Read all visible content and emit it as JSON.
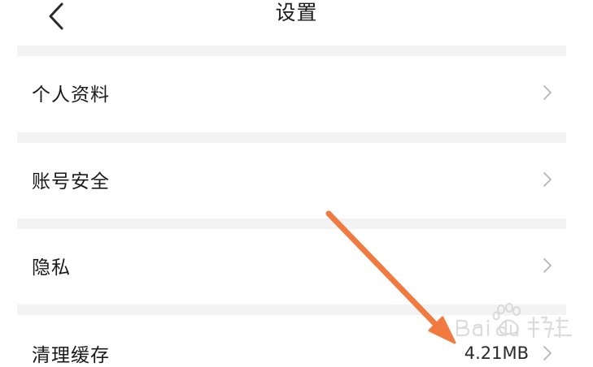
{
  "header": {
    "title": "设置",
    "back_icon": "chevron-left-icon"
  },
  "settings": {
    "items": [
      {
        "label": "个人资料",
        "value": ""
      },
      {
        "label": "账号安全",
        "value": ""
      },
      {
        "label": "隐私",
        "value": ""
      },
      {
        "label": "清理缓存",
        "value": "4.21MB"
      }
    ]
  },
  "colors": {
    "background": "#ffffff",
    "divider": "#f3f3f3",
    "text": "#1a1a1a",
    "chevron": "#b5b5b5",
    "annotation_arrow": "#f07a3f"
  }
}
